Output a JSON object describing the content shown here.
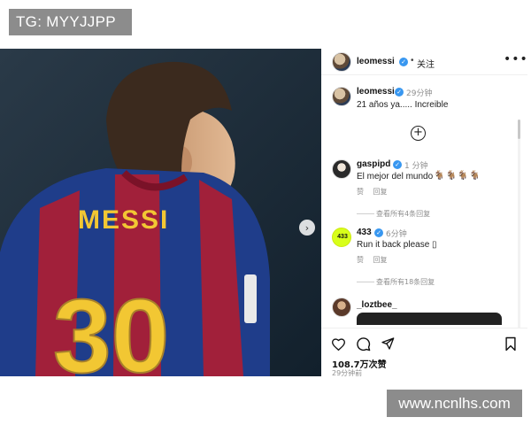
{
  "tg_badge": "TG: MYYJJPP",
  "watermark": "www.ncnlhs.com",
  "photo": {
    "jersey_name": "MESSI",
    "jersey_number": "30"
  },
  "header": {
    "username": "leomessi",
    "separator": "•",
    "follow_label": "关注",
    "more_icon": "more-options-icon"
  },
  "caption": {
    "username": "leomessi",
    "time": "29分钟",
    "text": "21 años ya..... Increible"
  },
  "comments": [
    {
      "username": "gaspipd",
      "time": "1 分钟",
      "text": "El mejor del mundo",
      "emoji": "🐐🐐🐐🐐",
      "like_label": "赞",
      "reply_label": "回复",
      "view_replies": "查看所有4条回复"
    },
    {
      "username": "433",
      "avatar_text": "433",
      "time": "6分钟",
      "text": "Run it back please ▯",
      "like_label": "赞",
      "reply_label": "回复",
      "view_replies": "查看所有18条回复"
    },
    {
      "username": "_loztbee_"
    }
  ],
  "actions": {
    "likes": "108.7万次赞",
    "posted": "29分钟前"
  },
  "colors": {
    "verified": "#3897f0",
    "badge_433": "#d8ff1a",
    "overlay_gray": "#8c8c8c"
  }
}
